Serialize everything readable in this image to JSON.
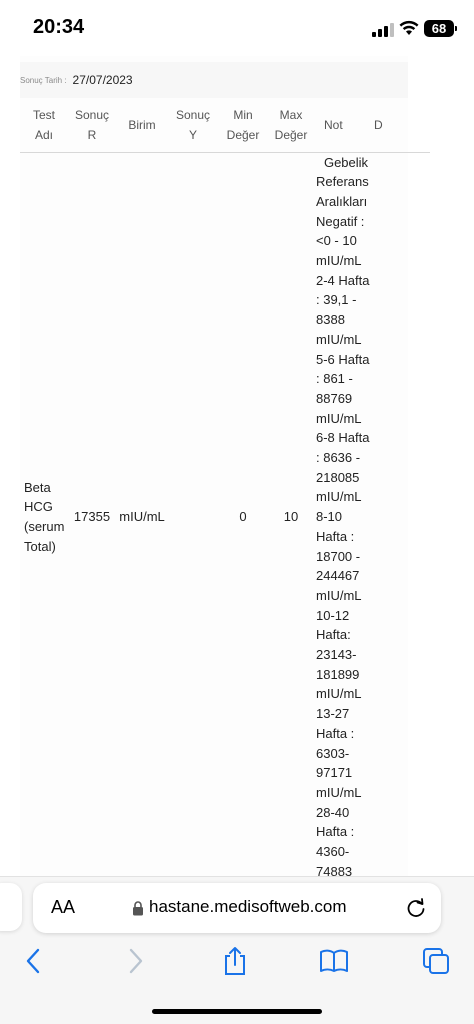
{
  "status_bar": {
    "time": "20:34",
    "battery": "68",
    "icons": [
      "signal-icon",
      "wifi-icon",
      "battery-icon"
    ]
  },
  "report": {
    "date_label": "Sonuç Tarih :",
    "date_value": "27/07/2023",
    "columns": {
      "test_adi": [
        "Test",
        "Adı"
      ],
      "sonuc_r": [
        "Sonuç",
        "R"
      ],
      "birim": "Birim",
      "sonuc_y": [
        "Sonuç",
        "Y"
      ],
      "min_deger": [
        "Min",
        "Değer"
      ],
      "max_deger": [
        "Max",
        "Değer"
      ],
      "not": "Not",
      "truncated": "D"
    },
    "row": {
      "test_adi": [
        "Beta",
        "HCG",
        "(serum",
        "Total)"
      ],
      "sonuc_r": "17355",
      "birim": "mIU/mL",
      "sonuc_y": "",
      "min_deger": "0",
      "max_deger": "10",
      "note_lines": [
        "Gebelik",
        "Referans",
        "Aralıkları",
        "Negatif :",
        "<0 - 10",
        "mIU/mL",
        "2-4 Hafta",
        ": 39,1 -",
        "8388",
        "mIU/mL",
        "5-6 Hafta",
        ": 861 -",
        "88769",
        "mIU/mL",
        "6-8 Hafta",
        ": 8636 -",
        "218085",
        "mIU/mL",
        "8-10",
        "Hafta :",
        "18700 -",
        "244467",
        "mIU/mL",
        "10-12",
        "Hafta:",
        "23143-",
        "181899",
        "mIU/mL",
        "13-27",
        "Hafta :",
        "6303-",
        "97171",
        "mIU/mL",
        "28-40",
        "Hafta :",
        "4360-",
        "74883"
      ]
    }
  },
  "browser": {
    "text_size_label": "AA",
    "url": "hastane.medisoftweb.com",
    "toolbar": [
      "back-icon",
      "forward-icon",
      "share-icon",
      "bookmarks-icon",
      "tabs-icon"
    ],
    "accent": "#1a73e8"
  }
}
